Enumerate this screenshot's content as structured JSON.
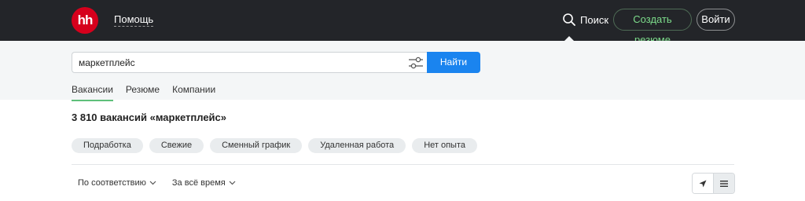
{
  "header": {
    "logo_text": "hh",
    "help_link": "Помощь",
    "search_label": "Поиск",
    "create_resume": "Создать резюме",
    "login": "Войти"
  },
  "search": {
    "query": "маркетплейс",
    "button": "Найти"
  },
  "tabs": [
    {
      "label": "Вакансии",
      "active": true
    },
    {
      "label": "Резюме",
      "active": false
    },
    {
      "label": "Компании",
      "active": false
    }
  ],
  "results": {
    "title": "3 810 вакансий «маркетплейс»"
  },
  "chips": [
    "Подработка",
    "Свежие",
    "Сменный график",
    "Удаленная работа",
    "Нет опыта"
  ],
  "sort": {
    "relevance": "По соответствию",
    "period": "За всё время"
  },
  "icons": {
    "logo": "hh-logo",
    "search": "search-icon",
    "filter": "filter-sliders-icon",
    "map": "map-arrow-icon",
    "list": "list-icon"
  },
  "colors": {
    "header_bg": "#232529",
    "logo_red": "#d6001c",
    "accent_blue": "#1a84ef",
    "accent_green": "#5ec07a"
  }
}
